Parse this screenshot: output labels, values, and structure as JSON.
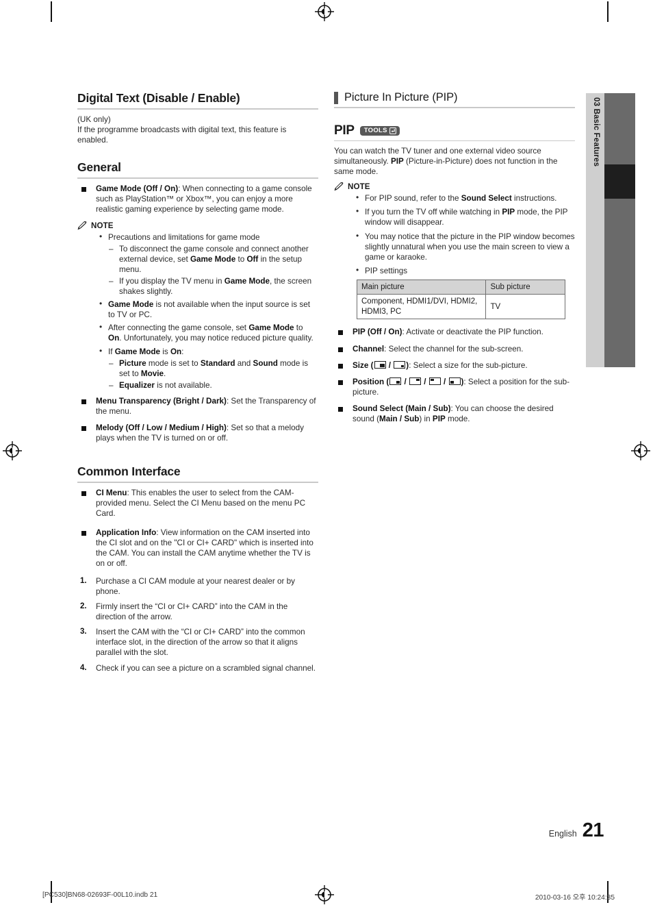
{
  "page": {
    "number": "21",
    "language": "English",
    "side_tab": "03  Basic Features",
    "print_file": "[PC530]BN68-02693F-00L10.indb   21",
    "print_timestamp": "2010-03-16   오후 10:24:35"
  },
  "left_column": {
    "digital_text": {
      "title": "Digital Text (Disable / Enable)",
      "line1": "(UK only)",
      "line2": "If the programme broadcasts with digital text, this feature is enabled."
    },
    "general": {
      "title": "General",
      "game_mode": {
        "label": "Game Mode (Off / On)",
        "text": ": When connecting to a game console such as PlayStation™ or Xbox™, you can enjoy a more realistic gaming experience by selecting game mode."
      },
      "note_label": "NOTE",
      "notes": [
        {
          "text": "Precautions and limitations for game mode",
          "sub": [
            "To disconnect the game console and connect another external device, set <b>Game Mode</b> to <b>Off</b> in the setup menu.",
            "If you display the TV menu in <b>Game Mode</b>, the screen shakes slightly."
          ]
        },
        {
          "html": "<b>Game Mode</b> is not available when the input source is set to TV or PC.",
          "sub": []
        },
        {
          "html": "After connecting the game console, set <b>Game Mode</b> to <b>On</b>. Unfortunately, you may notice reduced picture quality.",
          "sub": []
        },
        {
          "html": "If <b>Game Mode</b> is <b>On</b>:",
          "sub": [
            "<b>Picture</b> mode is set to <b>Standard</b> and <b>Sound</b> mode is set to <b>Movie</b>.",
            "<b>Equalizer</b> is not available."
          ]
        }
      ],
      "menu_transparency": {
        "label": "Menu Transparency (Bright / Dark)",
        "text": ": Set the Transparency of the menu."
      },
      "melody": {
        "label": "Melody (Off / Low / Medium / High)",
        "text": ": Set so that a melody plays when the TV is turned on or off."
      }
    },
    "common_interface": {
      "title": "Common Interface",
      "ci_menu": {
        "label": "CI Menu",
        "text": ": This enables the user to select from the CAM-provided menu. Select the CI Menu based on the menu PC Card."
      },
      "application_info": {
        "label": "Application Info",
        "text": ": View information on the CAM inserted into the CI slot and on the \"CI or CI+ CARD\" which is inserted into the CAM. You can install the CAM anytime whether the TV is on or off."
      },
      "steps": [
        {
          "n": "1.",
          "text": "Purchase a CI CAM module at your nearest dealer or by phone."
        },
        {
          "n": "2.",
          "text": "Firmly insert the “CI or CI+ CARD” into the CAM in the direction of the arrow."
        },
        {
          "n": "3.",
          "text": "Insert the CAM with the “CI or CI+ CARD” into the common interface slot, in the direction of the arrow so that it aligns parallel with the slot."
        },
        {
          "n": "4.",
          "text": "Check if you can see a picture on a scrambled signal channel."
        }
      ]
    }
  },
  "right_column": {
    "section_title": "Picture In Picture (PIP)",
    "pip": {
      "heading": "PIP",
      "tools_badge": "TOOLS",
      "intro": "You can watch the TV tuner and one external video source simultaneously. <b>PIP</b> (Picture-in-Picture) does not function in the same mode.",
      "note_label": "NOTE",
      "notes": [
        "For PIP sound, refer to the <b>Sound Select</b> instructions.",
        "If you turn the TV off while watching in <b>PIP</b> mode, the PIP window will disappear.",
        "You may notice that the picture in the PIP window becomes slightly unnatural when you use the main screen to view a game or karaoke.",
        "PIP settings"
      ],
      "table": {
        "headers": [
          "Main picture",
          "Sub picture"
        ],
        "rows": [
          [
            "Component, HDMI1/DVI, HDMI2, HDMI3, PC",
            "TV"
          ]
        ]
      },
      "options": [
        {
          "label": "PIP (Off / On)",
          "text": ": Activate or deactivate the PIP function."
        },
        {
          "label": "Channel",
          "text": ": Select the channel for the sub-screen."
        },
        {
          "label": "Size",
          "icons": [
            "size-big",
            "size-small"
          ],
          "text": ": Select a size for the sub-picture."
        },
        {
          "label": "Position",
          "icons": [
            "pos-br",
            "pos-tr",
            "pos-tl",
            "pos-bl"
          ],
          "text": ": Select a position for the sub-picture."
        },
        {
          "label": "Sound Select (Main / Sub)",
          "text": ": You can choose the desired sound (<b>Main / Sub</b>) in <b>PIP</b> mode."
        }
      ]
    }
  },
  "colors": {
    "rule": "#c9c9c9",
    "bar_mark": "#555555",
    "badge_bg": "#585858",
    "side_tab": "#cfcfcf",
    "side_bar": "#6a6a6a",
    "side_bar_active": "#1e1e1e",
    "table_header": "#d4d4d4"
  }
}
